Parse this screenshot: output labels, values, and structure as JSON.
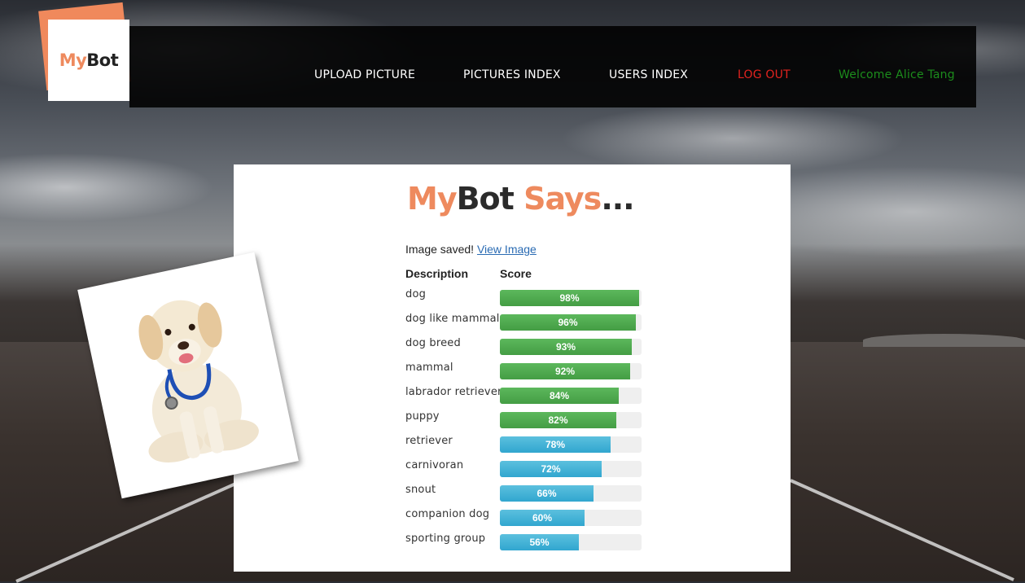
{
  "brand": {
    "logo_my": "My",
    "logo_bot": "Bot"
  },
  "nav": {
    "upload": "UPLOAD PICTURE",
    "pictures": "PICTURES INDEX",
    "users": "USERS INDEX",
    "logout": "LOG OUT",
    "welcome": "Welcome Alice Tang"
  },
  "result": {
    "title_my": "My",
    "title_bot": "Bot",
    "title_says": " Says",
    "title_dots": "...",
    "saved_text": "Image saved!",
    "view_link": "View Image",
    "col_description": "Description",
    "col_score": "Score",
    "rows": [
      {
        "label": "dog",
        "score": 98,
        "score_text": "98%",
        "color": "green"
      },
      {
        "label": "dog like mammal",
        "score": 96,
        "score_text": "96%",
        "color": "green"
      },
      {
        "label": "dog breed",
        "score": 93,
        "score_text": "93%",
        "color": "green"
      },
      {
        "label": "mammal",
        "score": 92,
        "score_text": "92%",
        "color": "green"
      },
      {
        "label": "labrador retriever",
        "score": 84,
        "score_text": "84%",
        "color": "green"
      },
      {
        "label": "puppy",
        "score": 82,
        "score_text": "82%",
        "color": "green"
      },
      {
        "label": "retriever",
        "score": 78,
        "score_text": "78%",
        "color": "blue"
      },
      {
        "label": "carnivoran",
        "score": 72,
        "score_text": "72%",
        "color": "blue"
      },
      {
        "label": "snout",
        "score": 66,
        "score_text": "66%",
        "color": "blue"
      },
      {
        "label": "companion dog",
        "score": 60,
        "score_text": "60%",
        "color": "blue"
      },
      {
        "label": "sporting group",
        "score": 56,
        "score_text": "56%",
        "color": "blue"
      }
    ]
  },
  "colors": {
    "accent": "#ee8a5e",
    "logout": "#e3231f",
    "welcome": "#1c8c1c",
    "bar_green": "#5cb85c",
    "bar_blue": "#5bc0de"
  }
}
